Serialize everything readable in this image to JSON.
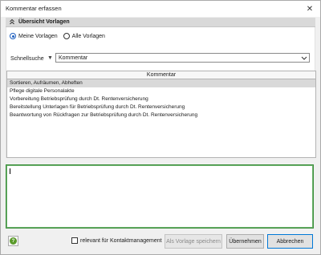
{
  "window": {
    "title": "Kommentar erfassen",
    "close_glyph": "✕"
  },
  "section": {
    "label": "Übersicht Vorlagen",
    "icon": "chevron-double-up-icon"
  },
  "scope": {
    "options": [
      {
        "label": "Meine Vorlagen",
        "selected": true
      },
      {
        "label": "Alle Vorlagen",
        "selected": false
      }
    ]
  },
  "search": {
    "label": "Schnellsuche",
    "filter_glyph": "▼",
    "value": "Kommentar"
  },
  "grid": {
    "column": "Kommentar",
    "rows": [
      {
        "text": "Sortieren, Aufräumen, Abheften",
        "selected": true
      },
      {
        "text": "Pflege digitale Personalakte",
        "selected": false
      },
      {
        "text": "Vorbereitung Betriebsprüfung durch Dt. Rentenversicherung",
        "selected": false
      },
      {
        "text": "Bereitstellung Unterlagen für Betriebsprüfung durch Dt. Rentenversicherung",
        "selected": false
      },
      {
        "text": "Beantwortung von Rückfragen zur Betriebsprüfung durch Dt. Rentenversicherung",
        "selected": false
      }
    ]
  },
  "comment": {
    "value": ""
  },
  "footer": {
    "help_glyph": "?",
    "checkbox_label": "relevant für Kontaktmanagement",
    "checkbox_checked": false,
    "save_template_label": "Als Vorlage speichern",
    "accept_label": "Übernehmen",
    "cancel_label": "Abbrechen"
  },
  "colors": {
    "accent": "#1e5fbf",
    "focus_border": "#3e8f3e",
    "selected_row": "#d9d9d9",
    "help_icon": "#5a9a2a"
  }
}
